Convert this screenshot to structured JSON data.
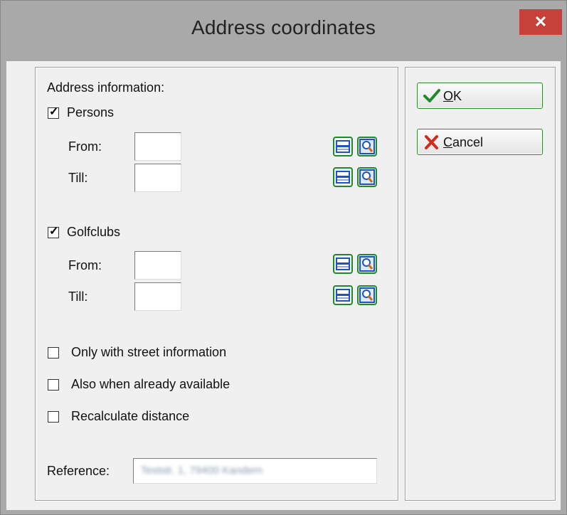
{
  "window": {
    "title": "Address coordinates",
    "close_glyph": "✕"
  },
  "address": {
    "heading": "Address information:",
    "persons": {
      "label": "Persons",
      "checked": true,
      "from_label": "From:",
      "till_label": "Till:",
      "from_value": "",
      "till_value": ""
    },
    "golfclubs": {
      "label": "Golfclubs",
      "checked": true,
      "from_label": "From:",
      "till_label": "Till:",
      "from_value": "",
      "till_value": ""
    }
  },
  "options": {
    "street": {
      "label": "Only with street information",
      "checked": false
    },
    "available": {
      "label": "Also when already available",
      "checked": false
    },
    "recalc": {
      "label": "Recalculate distance",
      "checked": false
    }
  },
  "reference": {
    "label": "Reference:",
    "value": "Teststr. 1, 79400 Kandern"
  },
  "buttons": {
    "ok": {
      "mnemonic": "O",
      "rest": "K",
      "icon": "checkmark-icon"
    },
    "cancel": {
      "mnemonic": "C",
      "rest": "ancel",
      "icon": "cross-icon"
    }
  },
  "icons": {
    "list": "table-icon",
    "search": "magnifier-icon"
  },
  "colors": {
    "accent_green": "#1e8a2a",
    "close_red": "#c7403a",
    "icon_blue": "#1e52c8"
  }
}
